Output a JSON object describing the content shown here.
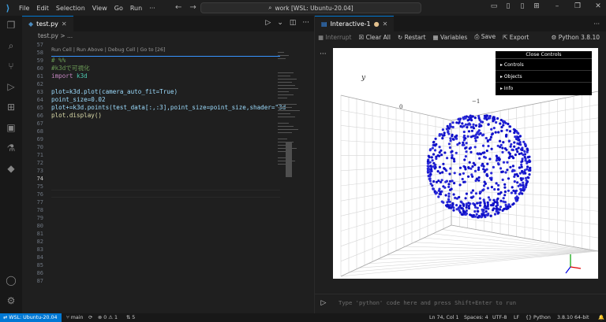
{
  "menu": [
    "File",
    "Edit",
    "Selection",
    "View",
    "Go",
    "Run",
    "···"
  ],
  "search": {
    "text": "work [WSL: Ubuntu-20.04]"
  },
  "editor": {
    "tab": "test.py",
    "breadcrumb": "test.py  >  ...",
    "cell_links": "Run Cell | Run Above | Debug Cell | Go to [26]",
    "line_numbers": [
      "57",
      "58",
      "59",
      "60",
      "61",
      "62",
      "63",
      "64",
      "65",
      "66",
      "67",
      "68",
      "69",
      "70",
      "71",
      "72",
      "73",
      "74",
      "75",
      "76",
      "77",
      "78",
      "79",
      "80",
      "81",
      "82",
      "83",
      "84",
      "85",
      "86",
      "87"
    ],
    "active_line": "74",
    "code": {
      "l58": "# %%",
      "l59": "#k3dで可視化",
      "l60_kw": "import",
      "l60_mod": " k3d",
      "l62": "plot=k3d.plot(camera_auto_fit=True)",
      "l63": "point_size=0.02",
      "l64": "plot+=k3d.points(test_data[:,:3],point_size=point_size,shader=\"3d",
      "l65": "plot.display()"
    }
  },
  "interactive": {
    "tab": "Interactive-1",
    "toolbar": {
      "interrupt": "Interrupt",
      "clear_all": "Clear All",
      "restart": "Restart",
      "variables": "Variables",
      "save": "Save",
      "export": "Export",
      "kernel": "Python 3.8.10"
    },
    "controls": {
      "title": "Close Controls",
      "items": [
        "Controls",
        "Objects",
        "Info"
      ]
    },
    "axis_labels": {
      "y": "y",
      "t0": "0",
      "t1": "−1"
    },
    "placeholder": "Type 'python' code here and press Shift+Enter to run"
  },
  "status": {
    "remote": "WSL: Ubuntu-20.04",
    "branch": "main",
    "errors": "0",
    "warnings": "1",
    "ports": "5",
    "position": "Ln 74, Col 1",
    "spaces": "Spaces: 4",
    "encoding": "UTF-8",
    "eol": "LF",
    "language": "Python",
    "interpreter": "3.8.10 64-bit"
  },
  "colors": {
    "accent": "#0078d4",
    "points": "#1010c8",
    "keyword": "#c586c0",
    "comment": "#6a9955"
  }
}
